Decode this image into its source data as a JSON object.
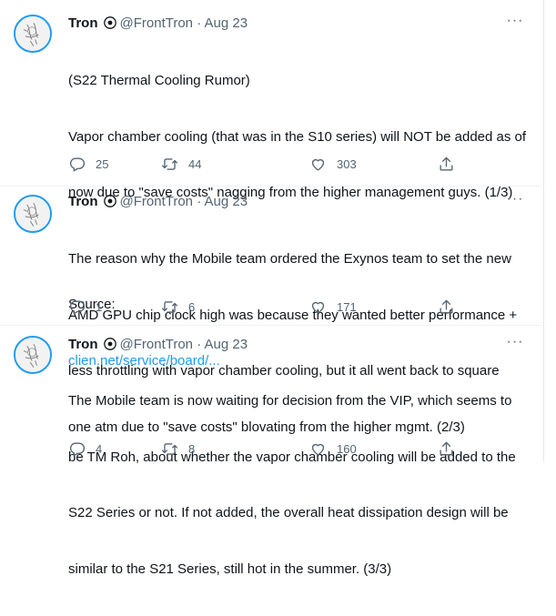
{
  "tweets": [
    {
      "author_name": "Tron",
      "handle": "@FrontTron",
      "separator": "·",
      "date": "Aug 23",
      "more_label": "···",
      "text_lines": [
        "(S22 Thermal Cooling Rumor)",
        "Vapor chamber cooling (that was in the S10 series) will NOT be added as of",
        "now due to \"save costs\" nagging from the higher management guys. (1/3)",
        "",
        "Source:"
      ],
      "link": "clien.net/service/board/...",
      "replies": "25",
      "retweets": "44",
      "likes": "303"
    },
    {
      "author_name": "Tron",
      "handle": "@FrontTron",
      "separator": "·",
      "date": "Aug 23",
      "more_label": "···",
      "text_lines": [
        "The reason why the Mobile team ordered the Exynos team to set the new",
        "AMD GPU chip clock high was because they wanted better performance +",
        "less throttling with vapor chamber cooling, but it all went back to square",
        "one atm due to \"save costs\" blovating from the higher mgmt. (2/3)"
      ],
      "replies": "1",
      "retweets": "6",
      "likes": "171"
    },
    {
      "author_name": "Tron",
      "handle": "@FrontTron",
      "separator": "·",
      "date": "Aug 23",
      "more_label": "···",
      "text_lines": [
        "The Mobile team is now waiting for decision from the VIP, which seems to",
        "be TM Roh, about whether the vapor chamber cooling will be added to the",
        "S22 Series or not. If not added, the overall heat dissipation design will be",
        "similar to the S21 Series, still hot in the summer. (3/3)"
      ],
      "replies": "4",
      "retweets": "8",
      "likes": "160"
    }
  ],
  "icons": {
    "reply": "reply-icon",
    "retweet": "retweet-icon",
    "like": "heart-icon",
    "share": "share-icon",
    "badge": "verified-badge-icon"
  },
  "colors": {
    "link": "#1d9bf0",
    "muted": "#536471",
    "avatar_ring": "#1d9bf0"
  }
}
